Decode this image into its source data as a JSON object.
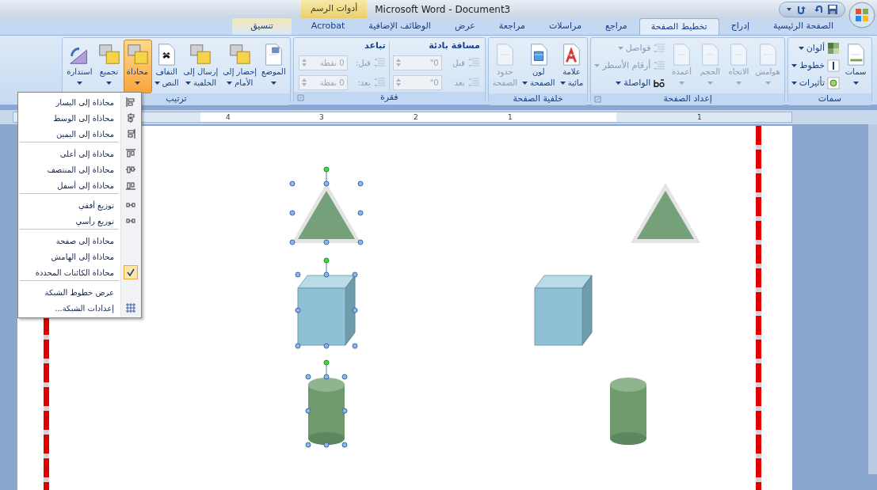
{
  "title_bar": {
    "title": "Microsoft Word - Document3",
    "context_label": "أدوات الرسم"
  },
  "tabs": [
    {
      "label": "الصفحة الرئيسية",
      "selected": false,
      "contextual": false
    },
    {
      "label": "إدراج",
      "selected": false,
      "contextual": false
    },
    {
      "label": "تخطيط الصفحة",
      "selected": true,
      "contextual": false
    },
    {
      "label": "مراجع",
      "selected": false,
      "contextual": false
    },
    {
      "label": "مراسلات",
      "selected": false,
      "contextual": false
    },
    {
      "label": "مراجعة",
      "selected": false,
      "contextual": false
    },
    {
      "label": "عرض",
      "selected": false,
      "contextual": false
    },
    {
      "label": "الوظائف الإضافية",
      "selected": false,
      "contextual": false
    },
    {
      "label": "Acrobat",
      "selected": false,
      "contextual": false
    },
    {
      "label": "تنسيق",
      "selected": false,
      "contextual": true
    }
  ],
  "ribbon": {
    "groups": [
      {
        "title": "سمات",
        "launcher": false,
        "columns": [
          {
            "items": [
              {
                "kind": "large",
                "label_lines": [
                  "سمات"
                ],
                "dropdown": true,
                "disabled": false,
                "selected": false
              }
            ]
          },
          {
            "items": [
              {
                "kind": "small",
                "label": "ألوان",
                "dropdown": true,
                "disabled": false
              },
              {
                "kind": "small",
                "label": "خطوط",
                "dropdown": true,
                "disabled": false
              },
              {
                "kind": "small",
                "label": "تأثيرات",
                "dropdown": true,
                "disabled": false
              }
            ]
          }
        ]
      },
      {
        "title": "إعداد الصفحة",
        "launcher": true,
        "columns": [
          {
            "items": [
              {
                "kind": "large",
                "label_lines": [
                  "هوامش"
                ],
                "dropdown": true,
                "disabled": true,
                "selected": false
              }
            ]
          },
          {
            "items": [
              {
                "kind": "large",
                "label_lines": [
                  "الاتجاه"
                ],
                "dropdown": true,
                "disabled": true,
                "selected": false
              }
            ]
          },
          {
            "items": [
              {
                "kind": "large",
                "label_lines": [
                  "الحجم"
                ],
                "dropdown": true,
                "disabled": true,
                "selected": false
              }
            ]
          },
          {
            "items": [
              {
                "kind": "large",
                "label_lines": [
                  "أعمدة"
                ],
                "dropdown": true,
                "disabled": true,
                "selected": false
              }
            ]
          },
          {
            "items": [
              {
                "kind": "small",
                "label": "فواصل",
                "dropdown": true,
                "disabled": true
              },
              {
                "kind": "small",
                "label": "أرقام الأسطر",
                "dropdown": true,
                "disabled": true
              },
              {
                "kind": "small",
                "label": "الواصلة",
                "dropdown": true,
                "disabled": false
              }
            ]
          }
        ]
      },
      {
        "title": "خلفية الصفحة",
        "launcher": false,
        "columns": [
          {
            "items": [
              {
                "kind": "large",
                "label_lines": [
                  "علامة",
                  "مائية"
                ],
                "dropdown": true,
                "disabled": false,
                "selected": false
              }
            ]
          },
          {
            "items": [
              {
                "kind": "large",
                "label_lines": [
                  "لون",
                  "الصفحة"
                ],
                "dropdown": true,
                "disabled": false,
                "selected": false
              }
            ]
          },
          {
            "items": [
              {
                "kind": "large",
                "label_lines": [
                  "حدود",
                  "الصفحة"
                ],
                "dropdown": false,
                "disabled": true,
                "selected": false
              }
            ]
          }
        ]
      },
      {
        "title": "فقرة",
        "launcher": true,
        "columns": [
          {
            "heading": "مسافة بادئة",
            "items": [
              {
                "kind": "spin",
                "label": "قبل",
                "value": "0\"",
                "disabled": true
              },
              {
                "kind": "spin",
                "label": "بعد",
                "value": "0\"",
                "disabled": true
              }
            ]
          },
          {
            "heading": "تباعد",
            "items": [
              {
                "kind": "spin",
                "label": "قبل:",
                "value": "0 نقطة",
                "disabled": true
              },
              {
                "kind": "spin",
                "label": "بعد:",
                "value": "0 نقطة",
                "disabled": true
              }
            ]
          }
        ]
      },
      {
        "title": "ترتيب",
        "launcher": false,
        "columns": [
          {
            "items": [
              {
                "kind": "large",
                "label_lines": [
                  "الموضع"
                ],
                "dropdown": true,
                "disabled": false,
                "selected": false
              }
            ]
          },
          {
            "items": [
              {
                "kind": "large",
                "label_lines": [
                  "إحضار إلى",
                  "الأمام"
                ],
                "dropdown": true,
                "disabled": false,
                "selected": false
              }
            ]
          },
          {
            "items": [
              {
                "kind": "large",
                "label_lines": [
                  "إرسال إلى",
                  "الخلفية"
                ],
                "dropdown": true,
                "disabled": false,
                "selected": false
              }
            ]
          },
          {
            "items": [
              {
                "kind": "large",
                "label_lines": [
                  "التفاف",
                  "النص"
                ],
                "dropdown": true,
                "disabled": false,
                "selected": false
              }
            ]
          },
          {
            "items": [
              {
                "kind": "large",
                "label_lines": [
                  "محاذاة"
                ],
                "dropdown": true,
                "disabled": false,
                "selected": true
              }
            ]
          },
          {
            "items": [
              {
                "kind": "large",
                "label_lines": [
                  "تجميع"
                ],
                "dropdown": true,
                "disabled": false,
                "selected": false
              }
            ]
          },
          {
            "items": [
              {
                "kind": "large",
                "label_lines": [
                  "استدارة"
                ],
                "dropdown": true,
                "disabled": false,
                "selected": false
              }
            ]
          }
        ]
      }
    ]
  },
  "ruler": {
    "labels": [
      "1",
      "1",
      "2",
      "3",
      "4"
    ]
  },
  "align_menu": {
    "items": [
      {
        "label": "محاذاة إلى اليسار",
        "checked": false,
        "separator_before": false
      },
      {
        "label": "محاذاة إلى الوسط",
        "checked": false,
        "separator_before": false
      },
      {
        "label": "محاذاة إلى اليمين",
        "checked": false,
        "separator_before": false
      },
      {
        "label": "محاذاة إلى أعلى",
        "checked": false,
        "separator_before": true
      },
      {
        "label": "محاذاة إلى المنتصف",
        "checked": false,
        "separator_before": false
      },
      {
        "label": "محاذاة إلى أسفل",
        "checked": false,
        "separator_before": false
      },
      {
        "label": "توزيع أفقي",
        "checked": false,
        "separator_before": true
      },
      {
        "label": "توزيع رأسي",
        "checked": false,
        "separator_before": false
      },
      {
        "label": "محاذاة إلى صفحة",
        "checked": false,
        "separator_before": true
      },
      {
        "label": "محاذاة إلى الهامش",
        "checked": false,
        "separator_before": false
      },
      {
        "label": "محاذاة الكائنات المحددة",
        "checked": true,
        "separator_before": false
      },
      {
        "label": "عرض خطوط الشبكة",
        "checked": false,
        "separator_before": true
      },
      {
        "label": "إعدادات الشبكة...",
        "checked": false,
        "separator_before": false
      }
    ]
  },
  "shapes": [
    {
      "kind": "triangle",
      "selected": true
    },
    {
      "kind": "triangle",
      "selected": false
    },
    {
      "kind": "cube",
      "selected": true
    },
    {
      "kind": "cube",
      "selected": false
    },
    {
      "kind": "cylinder",
      "selected": true
    },
    {
      "kind": "cylinder",
      "selected": false
    }
  ]
}
